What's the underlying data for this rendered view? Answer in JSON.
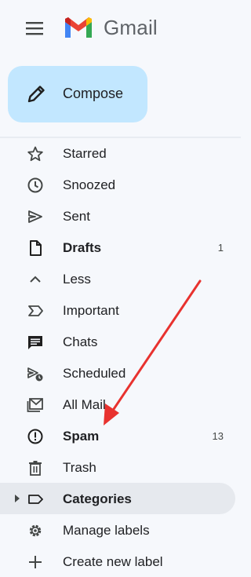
{
  "header": {
    "brand": "Gmail",
    "menu_icon": "hamburger-menu-icon",
    "logo_icon": "gmail-logo-icon"
  },
  "compose": {
    "label": "Compose",
    "icon": "pencil-icon",
    "color": "#c2e7ff"
  },
  "nav": {
    "items": [
      {
        "label": "Starred",
        "icon": "star-icon",
        "count": ""
      },
      {
        "label": "Snoozed",
        "icon": "clock-icon",
        "count": ""
      },
      {
        "label": "Sent",
        "icon": "send-icon",
        "count": ""
      },
      {
        "label": "Drafts",
        "icon": "draft-icon",
        "count": "1"
      },
      {
        "label": "Less",
        "icon": "chevron-up-icon",
        "count": ""
      },
      {
        "label": "Important",
        "icon": "important-icon",
        "count": ""
      },
      {
        "label": "Chats",
        "icon": "chat-icon",
        "count": ""
      },
      {
        "label": "Scheduled",
        "icon": "scheduled-icon",
        "count": ""
      },
      {
        "label": "All Mail",
        "icon": "all-mail-icon",
        "count": ""
      },
      {
        "label": "Spam",
        "icon": "spam-icon",
        "count": "13"
      },
      {
        "label": "Trash",
        "icon": "trash-icon",
        "count": ""
      },
      {
        "label": "Categories",
        "icon": "label-icon",
        "count": ""
      },
      {
        "label": "Manage labels",
        "icon": "gear-icon",
        "count": ""
      },
      {
        "label": "Create new label",
        "icon": "plus-icon",
        "count": ""
      }
    ]
  },
  "annotation": {
    "arrow_color": "#e8322f",
    "target": "Spam"
  }
}
